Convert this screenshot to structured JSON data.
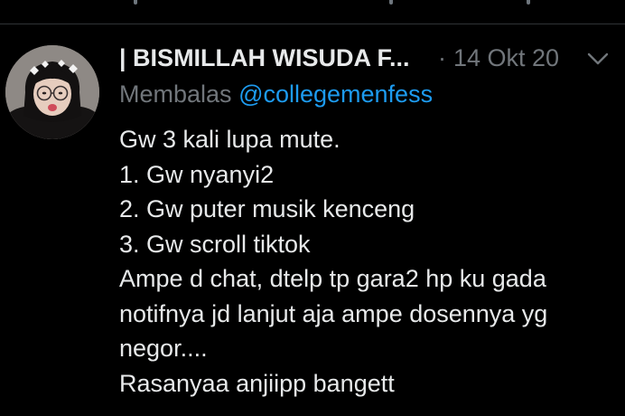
{
  "tweet": {
    "author_name": "| BISMILLAH WISUDA F...",
    "separator": "·",
    "date": "14 Okt 20",
    "reply_prefix": "Membalas",
    "reply_handle": "@collegemenfess",
    "lines": [
      "Gw 3 kali lupa mute.",
      "1. Gw nyanyi2",
      "2. Gw puter musik kenceng",
      "3. Gw scroll tiktok",
      "Ampe d chat, dtelp tp gara2 hp ku gada",
      "notifnya jd lanjut aja ampe dosennya yg",
      "negor....",
      "Rasanyaa anjiipp bangett"
    ],
    "more_icon": "chevron-down-icon"
  },
  "colors": {
    "background": "#000000",
    "text": "#e7e9ea",
    "muted": "#71767b",
    "link": "#1d9bf0",
    "divider": "#2f3336"
  }
}
